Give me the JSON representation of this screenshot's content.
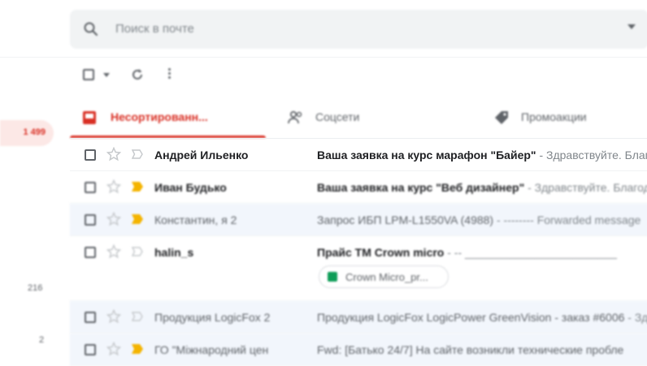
{
  "left_rail": {
    "inbox_count": "1 499",
    "counts": [
      "216",
      "2"
    ]
  },
  "search": {
    "placeholder": "Поиск в почте"
  },
  "toolbar": {
    "select_icon": "checkbox-icon",
    "refresh_icon": "refresh-icon",
    "more_icon": "more-vert-icon"
  },
  "tabs": [
    {
      "label": "Несортированн...",
      "icon": "inbox-icon",
      "active": true
    },
    {
      "label": "Соцсети",
      "icon": "people-icon",
      "active": false
    },
    {
      "label": "Промоакции",
      "icon": "tag-icon",
      "active": false
    }
  ],
  "emails": [
    {
      "sender": "Андрей Ильенко",
      "subject": "Ваша заявка на курс марафон \"Байер\"",
      "snippet": " - Здравствуйте. Благо",
      "unread": true,
      "important": false
    },
    {
      "sender": "Иван Будько",
      "subject": "Ваша заявка на курс \"Веб дизайнер\"",
      "snippet": " - Здравствуйте. Благод",
      "unread": true,
      "important": true
    },
    {
      "sender": "Константин, я 2",
      "subject": "Запрос ИБП LPM-L1550VA (4988)",
      "snippet": " - -------- Forwarded message",
      "unread": false,
      "important": true
    },
    {
      "sender": "halin_s",
      "subject": "Прайс TM Crown micro",
      "snippet": " - -- ________________________",
      "unread": true,
      "important": false,
      "attachment": "Crown Micro_pr..."
    },
    {
      "sender": "Продукция LogicFox 2",
      "subject": "Продукция LogicFox LogicPower GreenVision - заказ #6006",
      "snippet": " - Зд",
      "unread": false,
      "important": false
    },
    {
      "sender": "ГО \"Міжнародний цен",
      "subject": "Fwd: [Батько 24/7] На сайте возникли технические пробле",
      "snippet": "",
      "unread": false,
      "important": true
    }
  ],
  "colors": {
    "accent": "#d93025",
    "important": "#f4b400",
    "read_row_bg": "#f2f6fc"
  }
}
